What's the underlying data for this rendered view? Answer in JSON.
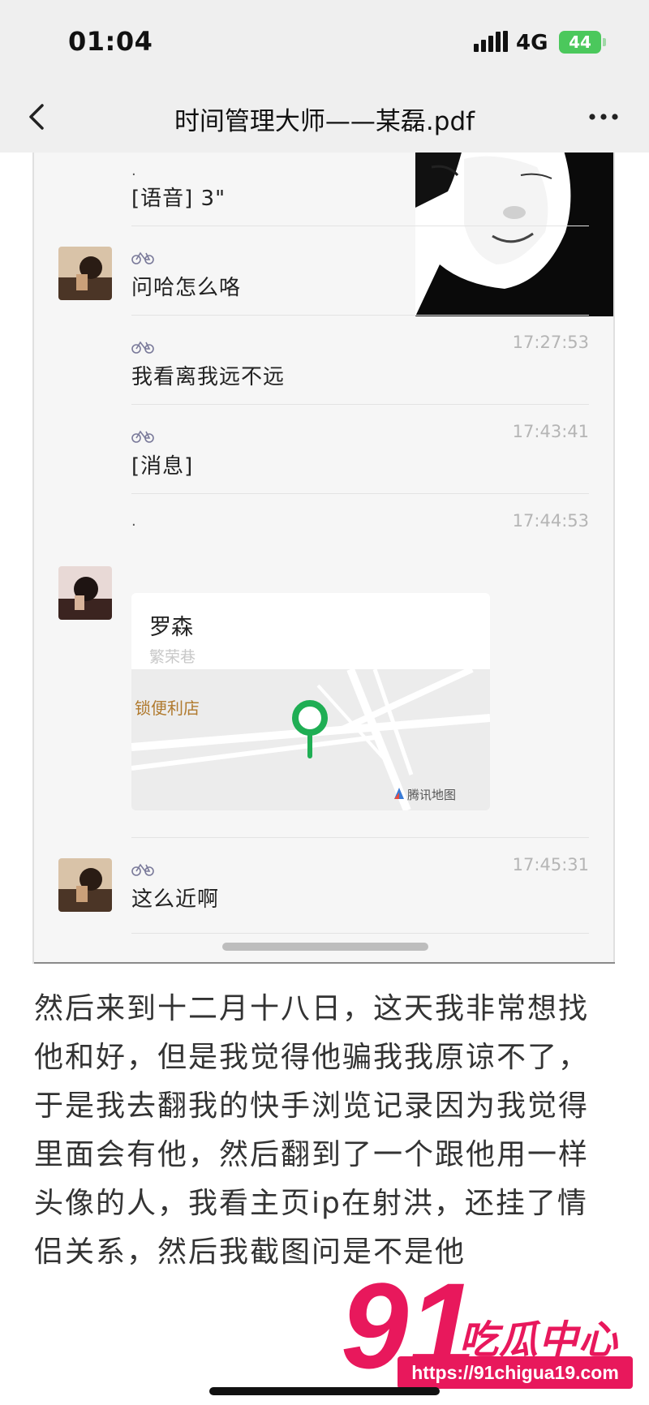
{
  "status_bar": {
    "time": "01:04",
    "network": "4G",
    "battery": "44"
  },
  "nav": {
    "title": "时间管理大师——某磊.pdf"
  },
  "chat": {
    "messages": [
      {
        "sender_mark": ".",
        "text": "[语音] 3\"",
        "time": ""
      },
      {
        "sender_mark": "bike",
        "text": "问哈怎么咯",
        "time": ""
      },
      {
        "sender_mark": "bike",
        "text": "我看离我远不远",
        "time": "17:27:53"
      },
      {
        "sender_mark": "bike",
        "text": "[消息]",
        "time": "17:43:41"
      },
      {
        "sender_mark": ".",
        "text": "",
        "time": "17:44:53"
      },
      {
        "sender_mark": "bike",
        "text": "这么近啊",
        "time": "17:45:31"
      }
    ],
    "location": {
      "name": "罗森",
      "address": "繁荣巷",
      "store_label": "锁便利店",
      "brand": "腾讯地图"
    }
  },
  "article": {
    "paragraph": "然后来到十二月十八日，这天我非常想找他和好，但是我觉得他骗我我原谅不了，于是我去翻我的快手浏览记录因为我觉得里面会有他，然后翻到了一个跟他用一样头像的人，我看主页ip在射洪，还挂了情侣关系，然后我截图问是不是他"
  },
  "watermark": {
    "number": "91",
    "name": "吃瓜中心",
    "url": "https://91chigua19.com"
  },
  "colors": {
    "accent": "#e8185c",
    "pin": "#1fae54",
    "battery": "#4bc85c"
  }
}
